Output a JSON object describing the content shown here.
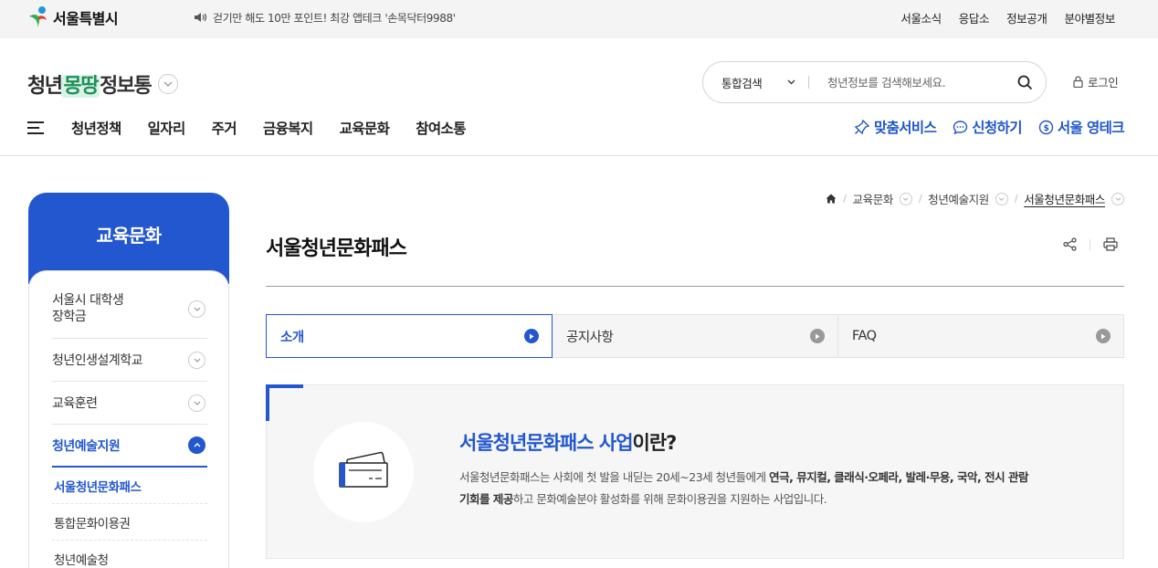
{
  "topbar": {
    "logo_text": "서울특별시",
    "notice": "걷기만 해도 10만 포인트! 최강 앱테크 '손목닥터9988'",
    "links": [
      "서울소식",
      "응답소",
      "정보공개",
      "분야별정보"
    ]
  },
  "header": {
    "brand": {
      "part1": "청년",
      "part2": "몽땅",
      "part3": "정보통"
    },
    "search": {
      "scope": "통합검색",
      "placeholder": "청년정보를 검색해보세요."
    },
    "login_label": "로그인",
    "gnb": [
      "청년정책",
      "일자리",
      "주거",
      "금융복지",
      "교육문화",
      "참여소통"
    ],
    "quick": [
      "맞춤서비스",
      "신청하기",
      "서울 영테크"
    ]
  },
  "lnb": {
    "title": "교육문화",
    "items": [
      {
        "line1": "서울시 대학생",
        "line2": "장학금"
      },
      {
        "label": "청년인생설계학교"
      },
      {
        "label": "교육훈련"
      },
      {
        "label": "청년예술지원"
      }
    ],
    "sub_items": [
      "서울청년문화패스",
      "통합문화이용권",
      "청년예술청"
    ]
  },
  "breadcrumb": [
    "교육문화",
    "청년예술지원",
    "서울청년문화패스"
  ],
  "page_title": "서울청년문화패스",
  "tabs": [
    "소개",
    "공지사항",
    "FAQ"
  ],
  "intro": {
    "title_highlight": "서울청년문화패스 사업",
    "title_rest": "이란?",
    "desc_1": "서울청년문화패스는 사회에 첫 발을 내딛는 20세~23세 청년들에게 ",
    "desc_bold_1": "연극, 뮤지컬, 클래식·오페라, 발레·무용, 국악, 전시 관람",
    "desc_bold_2": "기회를 제공",
    "desc_2": "하고 문화예술분야 활성화를 위해 문화이용권을 지원하는 사업입니다."
  },
  "colors": {
    "accent": "#2357d0",
    "topbar_bg": "#f4f4f4"
  }
}
